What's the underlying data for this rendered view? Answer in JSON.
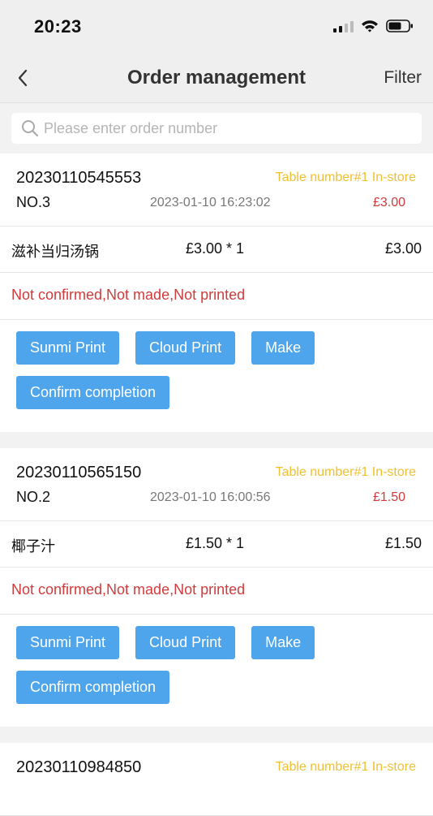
{
  "status_bar": {
    "time": "20:23"
  },
  "navbar": {
    "title": "Order management",
    "filter_label": "Filter"
  },
  "search": {
    "placeholder": "Please enter order number"
  },
  "orders": [
    {
      "order_number": "20230110545553",
      "table_info": "Table number#1 In-store",
      "seq": "NO.3",
      "time": "2023-01-10 16:23:02",
      "total": "£3.00",
      "item": {
        "name": "滋补当归汤锅",
        "qty": "£3.00 * 1",
        "subtotal": "£3.00"
      },
      "status": "Not confirmed,Not made,Not printed",
      "buttons": {
        "sunmi": "Sunmi Print",
        "cloud": "Cloud Print",
        "make": "Make",
        "confirm": "Confirm completion"
      }
    },
    {
      "order_number": "20230110565150",
      "table_info": "Table number#1 In-store",
      "seq": "NO.2",
      "time": "2023-01-10 16:00:56",
      "total": "£1.50",
      "item": {
        "name": "椰子汁",
        "qty": "£1.50 * 1",
        "subtotal": "£1.50"
      },
      "status": "Not confirmed,Not made,Not printed",
      "buttons": {
        "sunmi": "Sunmi Print",
        "cloud": "Cloud Print",
        "make": "Make",
        "confirm": "Confirm completion"
      }
    },
    {
      "order_number": "20230110984850",
      "table_info": "Table number#1 In-store"
    }
  ],
  "colors": {
    "accent": "#4ea5ec",
    "table_info": "#f0c030",
    "alert": "#d23b3b"
  },
  "icons": [
    "back-chevron-icon",
    "search-icon",
    "signal-icon",
    "wifi-icon",
    "battery-icon"
  ]
}
